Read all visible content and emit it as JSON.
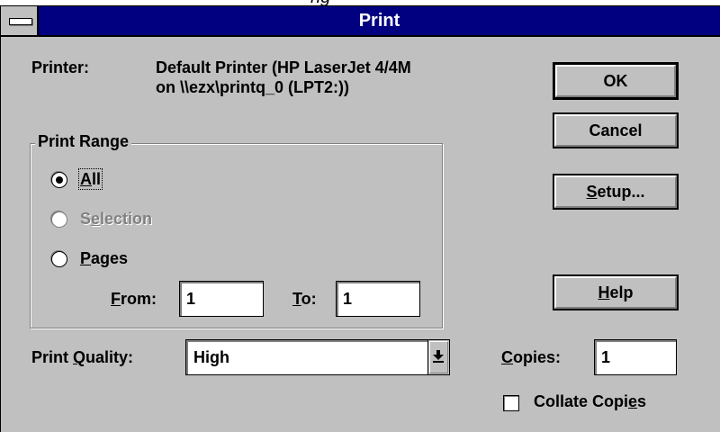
{
  "window": {
    "title": "Print",
    "partial_text_above": "ng"
  },
  "printer": {
    "label": "Printer:",
    "line1": "Default Printer (HP LaserJet 4/4M",
    "line2": "on \\\\ezx\\printq_0 (LPT2:))"
  },
  "buttons": {
    "ok": "OK",
    "cancel": "Cancel",
    "setup": {
      "key": "S",
      "rest": "etup..."
    },
    "help": {
      "key": "H",
      "rest": "elp"
    }
  },
  "print_range": {
    "title": "Print Range",
    "selected": "All",
    "all": {
      "key": "A",
      "rest": "ll"
    },
    "selection": {
      "pre": "S",
      "key": "e",
      "rest": "lection",
      "enabled": false
    },
    "pages": {
      "key": "P",
      "rest": "ages"
    },
    "from": {
      "key": "F",
      "rest": "rom:",
      "value": "1"
    },
    "to": {
      "key": "T",
      "rest": "o:",
      "value": "1"
    }
  },
  "quality": {
    "label_pre": "Print ",
    "label_key": "Q",
    "label_rest": "uality:",
    "value": "High"
  },
  "copies": {
    "key": "C",
    "rest": "opies:",
    "value": "1"
  },
  "collate": {
    "pre": "Collate Copi",
    "key": "e",
    "rest": "s",
    "checked": false
  }
}
